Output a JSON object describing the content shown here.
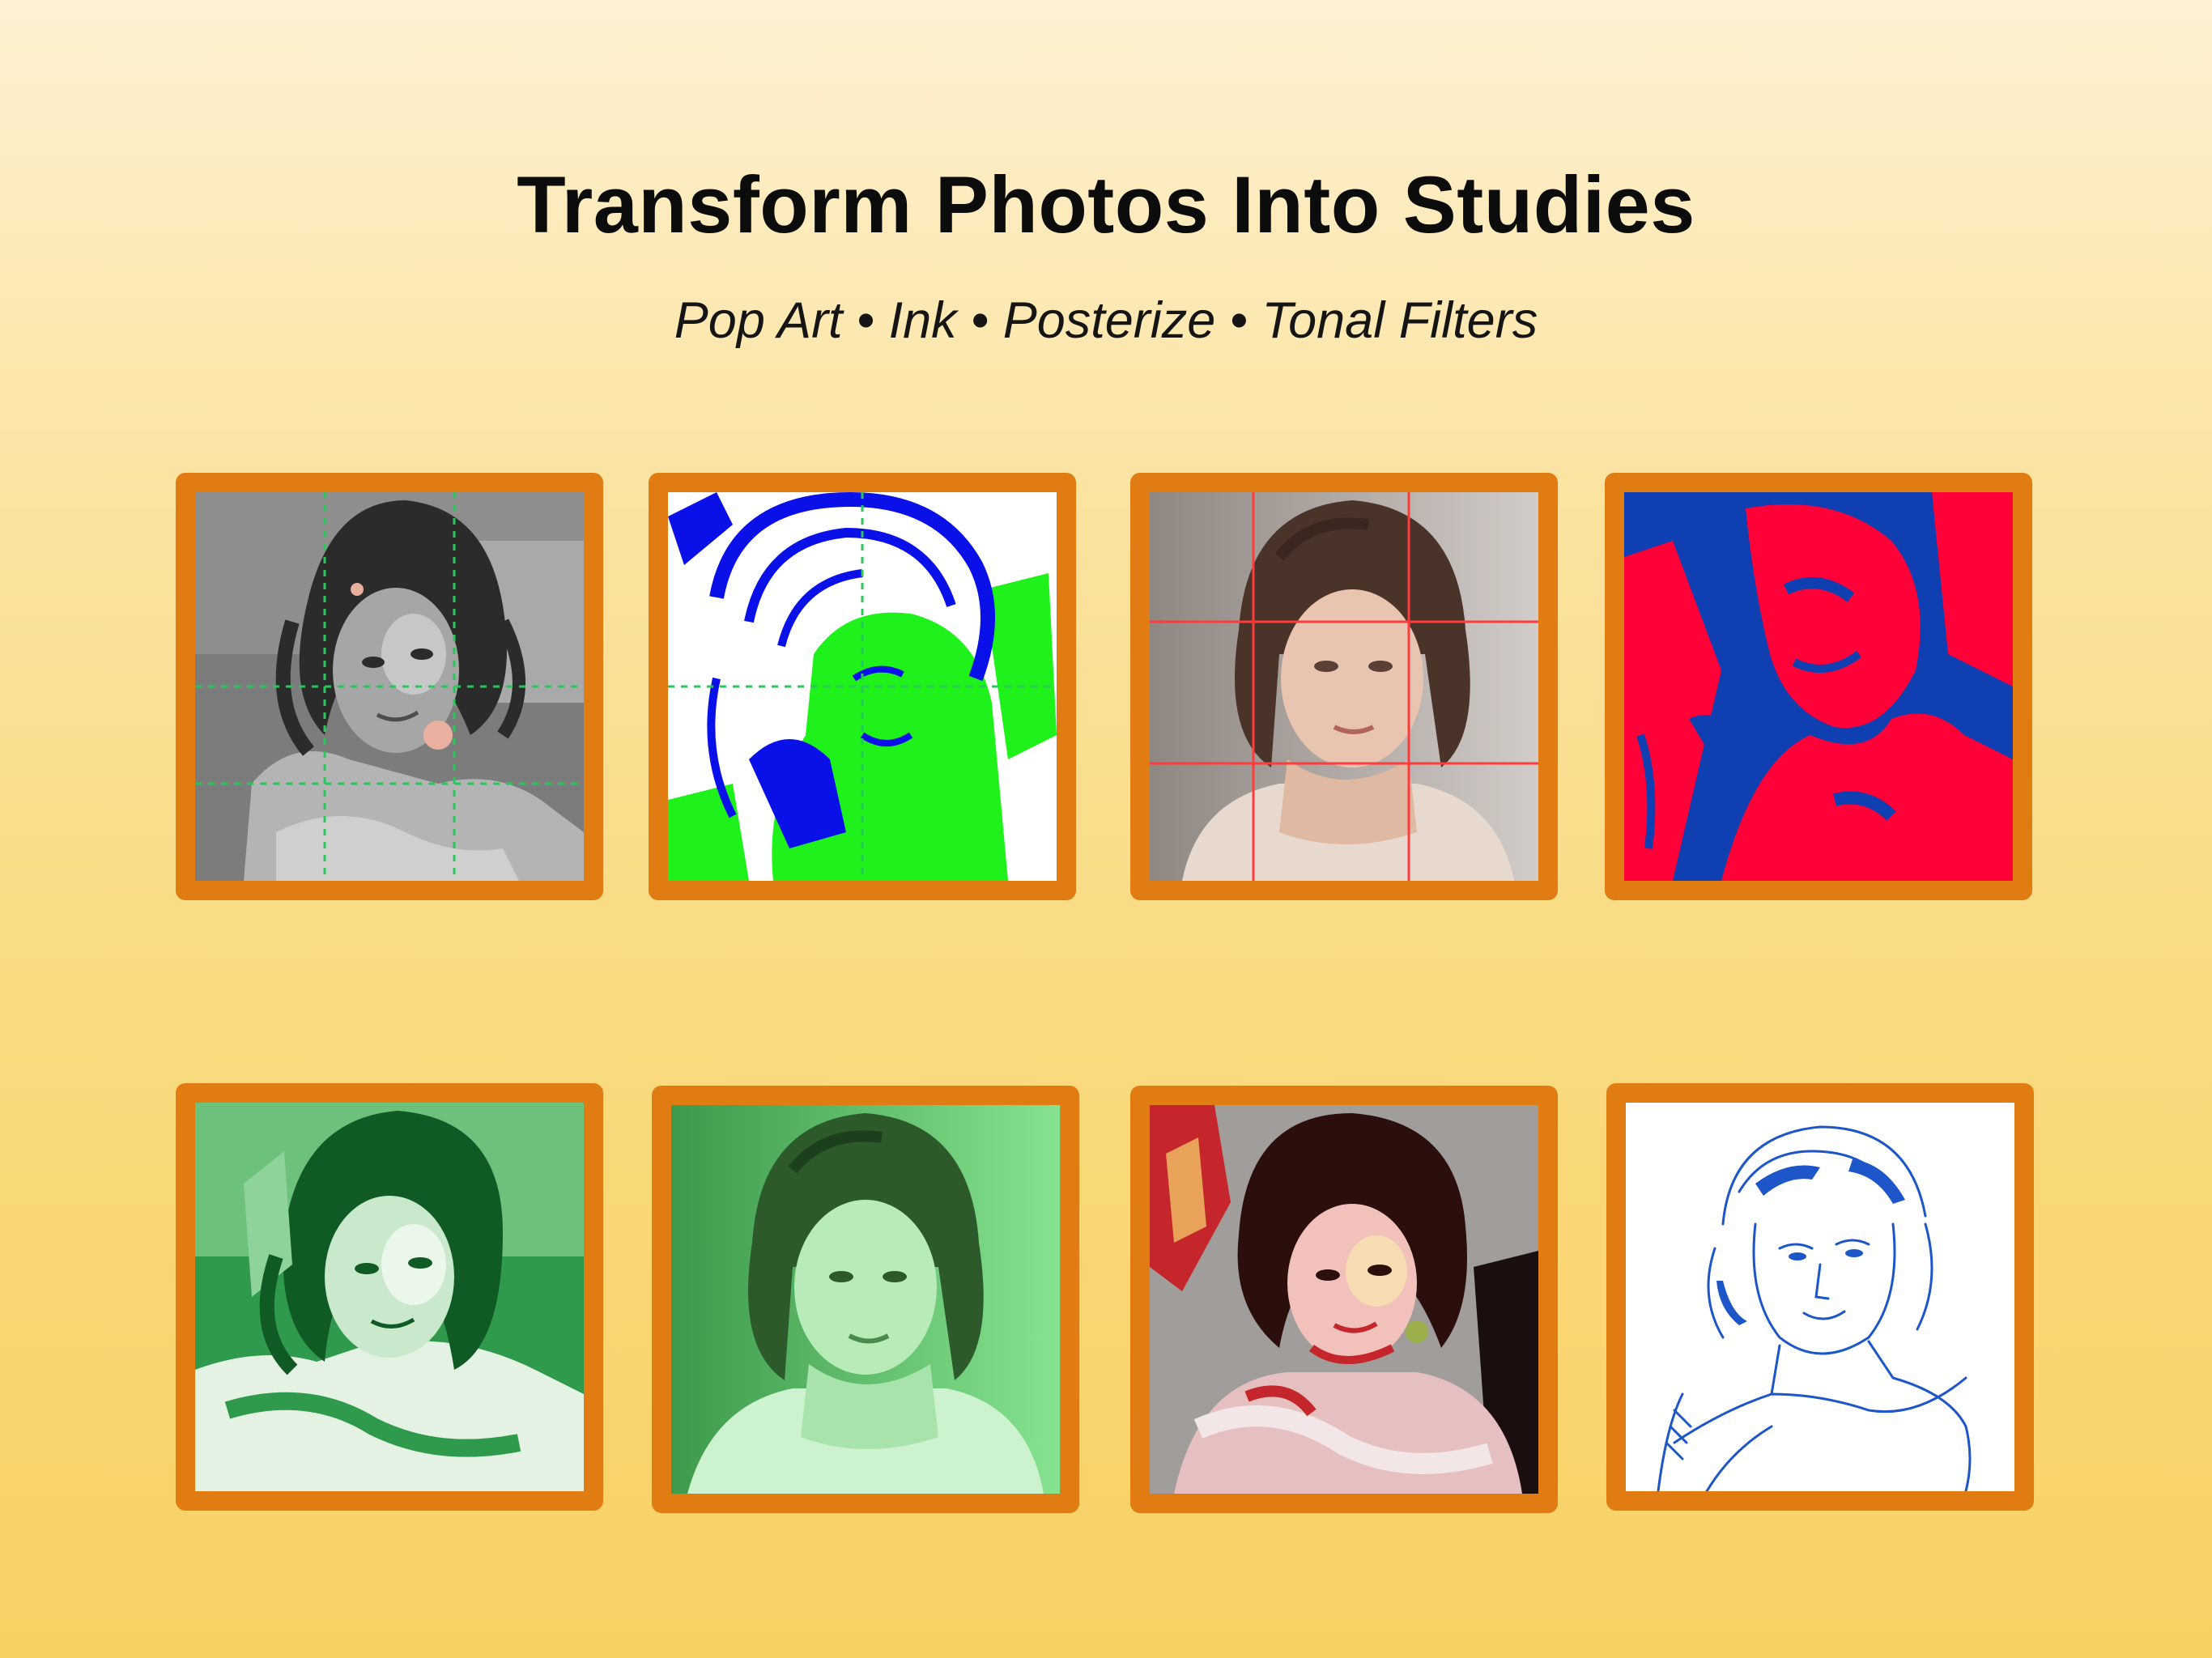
{
  "header": {
    "title": "Transform Photos Into Studies",
    "subtitle": "Pop Art • Ink • Posterize • Tonal Filters"
  },
  "colors": {
    "frame": "#e07c12",
    "background_top": "#fdf1d2",
    "background_bottom": "#f8d164"
  },
  "gallery": {
    "tiles": [
      {
        "name": "grayscale-posterize-study",
        "grid_color": "#27c95a"
      },
      {
        "name": "blue-green-ink-study",
        "grid_color": "#27c95a"
      },
      {
        "name": "photo-with-red-grid-study",
        "grid_color": "#ff3b3b"
      },
      {
        "name": "red-blue-pop-art-study"
      },
      {
        "name": "green-posterize-study"
      },
      {
        "name": "green-tonal-filter-study"
      },
      {
        "name": "multicolor-posterize-study"
      },
      {
        "name": "blue-line-sketch-study"
      }
    ]
  }
}
